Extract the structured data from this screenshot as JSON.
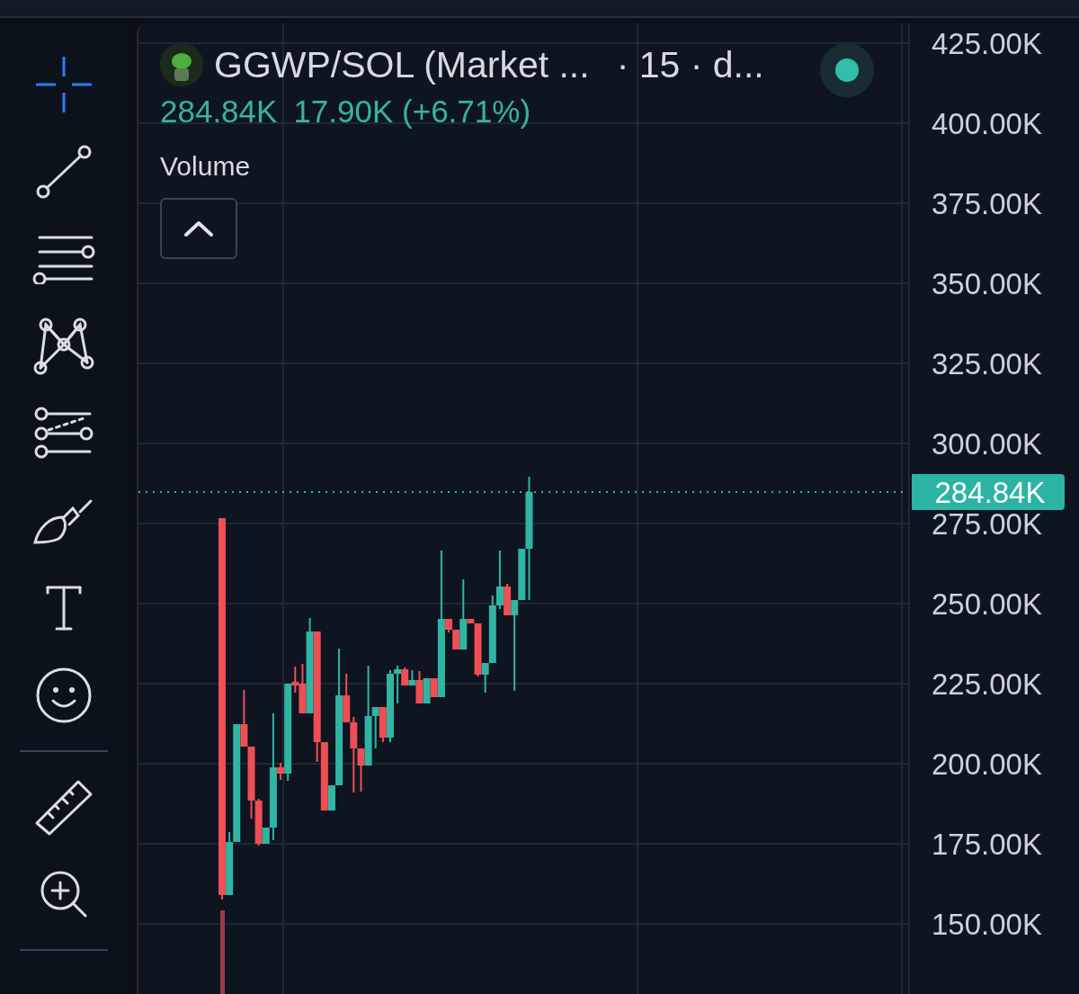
{
  "toolbar": {
    "tools": [
      {
        "selected": true
      },
      {
        "selected": false
      },
      {
        "selected": false
      },
      {
        "selected": false
      },
      {
        "selected": false
      },
      {
        "selected": false
      },
      {
        "selected": false
      },
      {
        "selected": false
      }
    ],
    "measure_tools": [
      {
        "selected": false
      },
      {
        "selected": false
      }
    ]
  },
  "legend": {
    "symbol": "GGWP/SOL (Market ...",
    "interval": "· 15 · d...",
    "last_price": "284.84K",
    "change": "17.90K (+6.71%)",
    "live": true
  },
  "indicator": {
    "label": "Volume",
    "collapsed": false
  },
  "price_axis": {
    "labels": [
      "425.00K",
      "400.00K",
      "375.00K",
      "350.00K",
      "325.00K",
      "300.00K",
      "275.00K",
      "250.00K",
      "225.00K",
      "200.00K",
      "175.00K",
      "150.00K"
    ],
    "current_price": "284.84K"
  }
}
